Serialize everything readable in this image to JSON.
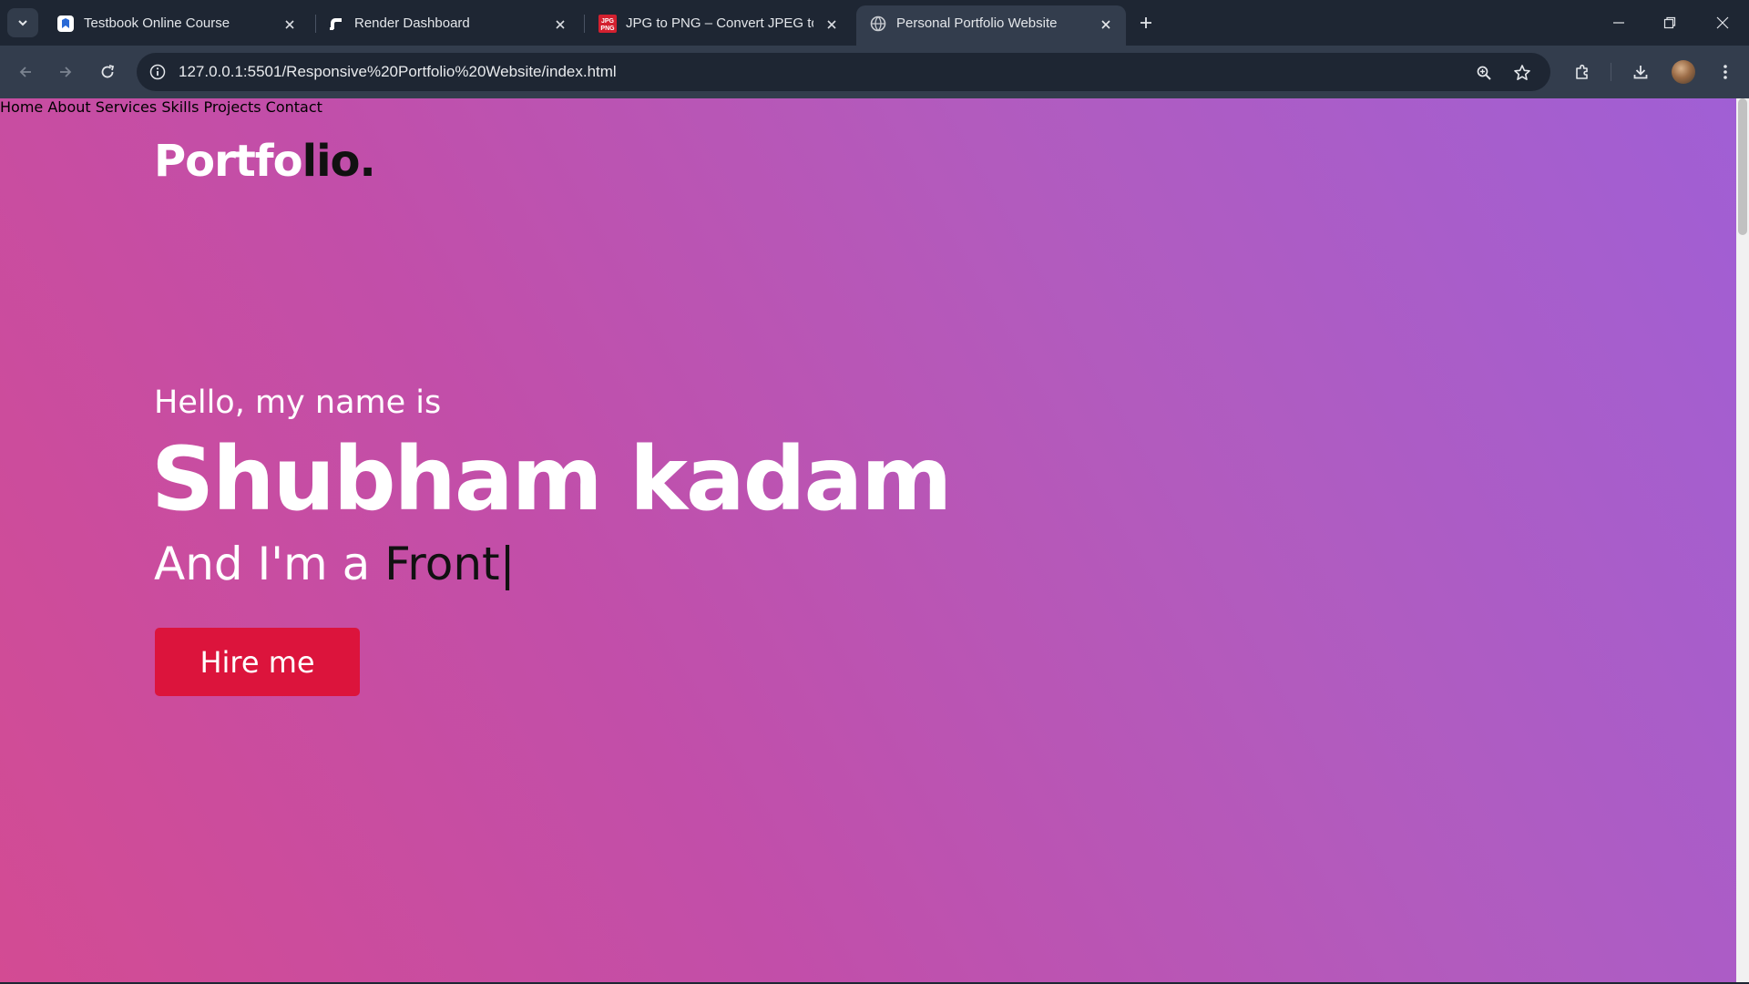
{
  "browser": {
    "tabs": [
      {
        "title": "Testbook Online Course",
        "icon": "testbook-favicon-icon",
        "active": false
      },
      {
        "title": "Render Dashboard",
        "icon": "render-favicon-icon",
        "active": false
      },
      {
        "title": "JPG to PNG – Convert JPEG to PNG",
        "icon": "jpg-png-favicon-icon",
        "active": false
      },
      {
        "title": "Personal Portfolio Website",
        "icon": "globe-icon",
        "active": true
      }
    ],
    "url": "127.0.0.1:5501/Responsive%20Portfolio%20Website/index.html",
    "colors": {
      "tabbar": "#1e2633",
      "toolbar": "#333d4d",
      "omnibox": "#1e2633"
    }
  },
  "page": {
    "logo": {
      "light": "Portfo",
      "dark": "lio."
    },
    "nav": [
      "Home",
      "About",
      "Services",
      "Skills",
      "Projects",
      "Contact"
    ],
    "hero": {
      "greeting": "Hello, my name is",
      "name": "Shubham kadam",
      "role_prefix": "And I'm a ",
      "role_typed": "Front",
      "cursor": "|",
      "button": "Hire me"
    },
    "colors": {
      "gradient_start": "#d34b93",
      "gradient_end": "#a05fd5",
      "button": "#dc143c",
      "accent_dark": "#111111"
    }
  }
}
